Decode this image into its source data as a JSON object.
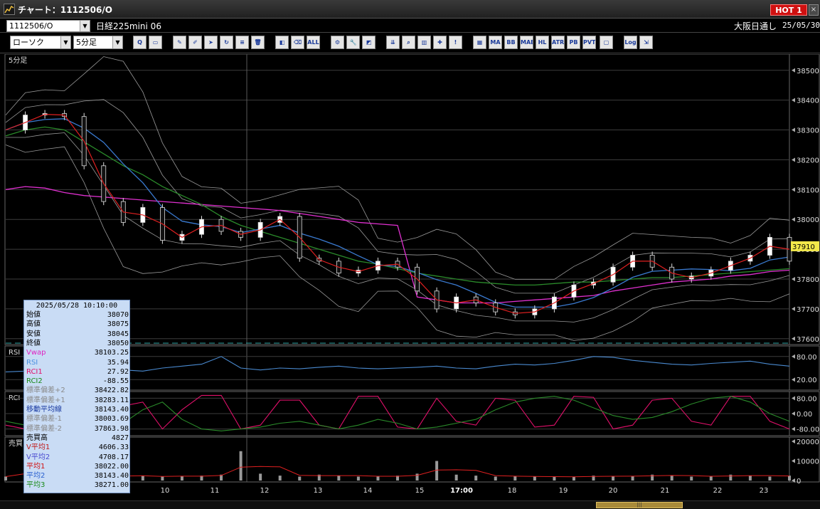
{
  "window": {
    "title": "チャート：1112506/O",
    "hot_label": "HOT 1",
    "close_label": "×"
  },
  "symbol_bar": {
    "code": "1112506/O",
    "product": "日経225mini 06",
    "session": "大阪日通し",
    "date": "25/05/30"
  },
  "selectors": {
    "chart_type": "ローソク",
    "interval": "5分足"
  },
  "toolbar_buttons": [
    {
      "name": "zoom-tool",
      "icon": "magnifier-icon",
      "label": "Q"
    },
    {
      "name": "window-tool",
      "icon": "window-icon",
      "label": "▭"
    },
    {
      "name": "pen-tool",
      "icon": "pen-icon",
      "label": "✎"
    },
    {
      "name": "draw-tool",
      "icon": "draw-icon",
      "label": "✐"
    },
    {
      "name": "cursor-tool",
      "icon": "cursor-icon",
      "label": "➤"
    },
    {
      "name": "redo-tool",
      "icon": "redo-icon",
      "label": "↻"
    },
    {
      "name": "notes-tool",
      "icon": "notes-icon",
      "label": "≡"
    },
    {
      "name": "trash-tool",
      "icon": "trash-icon",
      "label": "🗑"
    },
    {
      "name": "hide-tool",
      "icon": "hide-icon",
      "label": "◧"
    },
    {
      "name": "delete-tool",
      "icon": "delete-icon",
      "label": "⌫"
    },
    {
      "name": "all-tool",
      "icon": "all-icon",
      "label": "ALL"
    },
    {
      "name": "settings-tool",
      "icon": "gear-icon",
      "label": "⚙"
    },
    {
      "name": "wrench-tool",
      "icon": "wrench-icon",
      "label": "🔧"
    },
    {
      "name": "color-tool",
      "icon": "palette-icon",
      "label": "◩"
    },
    {
      "name": "order-tool",
      "icon": "order-icon",
      "label": "⇊"
    },
    {
      "name": "search-tool",
      "icon": "search-icon",
      "label": "⌕"
    },
    {
      "name": "chart-tool",
      "icon": "chart-icon",
      "label": "▥"
    },
    {
      "name": "mark-tool",
      "icon": "mark-icon",
      "label": "✚"
    },
    {
      "name": "disabled-tool",
      "icon": "disabled-icon",
      "label": "!"
    },
    {
      "name": "volume-tool",
      "icon": "volume-icon",
      "label": "▦"
    },
    {
      "name": "ma-tool",
      "icon": "ma-icon",
      "label": "MA"
    },
    {
      "name": "bb-tool",
      "icon": "bb-icon",
      "label": "BB"
    },
    {
      "name": "mae-tool",
      "icon": "mae-icon",
      "label": "MAE"
    },
    {
      "name": "hl-tool",
      "icon": "hl-icon",
      "label": "HL"
    },
    {
      "name": "atr-tool",
      "icon": "atr-icon",
      "label": "ATR"
    },
    {
      "name": "pb-tool",
      "icon": "pb-icon",
      "label": "PB"
    },
    {
      "name": "pvt-tool",
      "icon": "pvt-icon",
      "label": "PVT"
    },
    {
      "name": "frame-tool",
      "icon": "frame-icon",
      "label": "▢"
    },
    {
      "name": "log-tool",
      "icon": "log-icon",
      "label": "Log"
    },
    {
      "name": "export-tool",
      "icon": "export-icon",
      "label": "⇲"
    }
  ],
  "panes": {
    "price_label": "5分足",
    "rsi_label": "RSI",
    "rci_label": "RCI",
    "volume_label": "売買"
  },
  "price_axis": {
    "ticks": [
      "38500",
      "38400",
      "38300",
      "38200",
      "38100",
      "38000",
      "37900",
      "37800",
      "37700",
      "37600"
    ],
    "current": "37910"
  },
  "rsi_axis": {
    "ticks": [
      "80.00",
      "20.00"
    ]
  },
  "rci_axis": {
    "ticks": [
      "80.00",
      "0.00",
      "-80.00"
    ]
  },
  "volume_axis": {
    "ticks": [
      "20000",
      "10000",
      "0"
    ]
  },
  "time_axis": {
    "ticks": [
      "10",
      "11",
      "12",
      "13",
      "14",
      "15",
      "17:00",
      "18",
      "19",
      "20",
      "21",
      "22",
      "23"
    ]
  },
  "info_panel": {
    "datetime": "2025/05/28 10:10:00",
    "rows": [
      {
        "label": "始値",
        "value": "38070",
        "color": "#000000"
      },
      {
        "label": "高値",
        "value": "38075",
        "color": "#000000"
      },
      {
        "label": "安値",
        "value": "38045",
        "color": "#000000"
      },
      {
        "label": "終値",
        "value": "38050",
        "color": "#000000"
      },
      {
        "label": "Vwap",
        "value": "38103.25",
        "color": "#e020c0"
      },
      {
        "label": "RSI",
        "value": "35.94",
        "color": "#4a90e0"
      },
      {
        "label": "RCI1",
        "value": "27.92",
        "color": "#e0106a"
      },
      {
        "label": "RCI2",
        "value": "-88.55",
        "color": "#1a8a1a"
      },
      {
        "label": "標準偏差+2",
        "value": "38422.82",
        "color": "#8a8a8a"
      },
      {
        "label": "標準偏差+1",
        "value": "38283.11",
        "color": "#8a8a8a"
      },
      {
        "label": "移動平均線",
        "value": "38143.40",
        "color": "#1a3aa0"
      },
      {
        "label": "標準偏差-1",
        "value": "38003.69",
        "color": "#8a8a8a"
      },
      {
        "label": "標準偏差-2",
        "value": "37863.98",
        "color": "#8a8a8a"
      },
      {
        "label": "売買高",
        "value": "4827",
        "color": "#000000"
      },
      {
        "label": "V平均1",
        "value": "4606.33",
        "color": "#c01a1a"
      },
      {
        "label": "V平均2",
        "value": "4708.17",
        "color": "#4a4ad0"
      },
      {
        "label": "平均1",
        "value": "38022.00",
        "color": "#d01010"
      },
      {
        "label": "平均2",
        "value": "38143.40",
        "color": "#2a60d0"
      },
      {
        "label": "平均3",
        "value": "38271.00",
        "color": "#1a8a1a"
      }
    ]
  },
  "colors": {
    "ma_short": "#e02020",
    "ma_mid": "#3a7ad0",
    "ma_long": "#2a8a2a",
    "vwap": "#e030d0",
    "bollinger": "#9a9a9a",
    "rsi": "#4a8ad0",
    "rci1": "#e0106a",
    "rci2": "#2a8a2a",
    "volume": "#9a9a9a"
  },
  "chart_data": {
    "type": "line",
    "price_range": [
      37590,
      38540
    ],
    "x": [
      0,
      5,
      10,
      15,
      20,
      25,
      30,
      35,
      40,
      45,
      50,
      55,
      60,
      65,
      70,
      75,
      80,
      85,
      90,
      95,
      100,
      105,
      110,
      115,
      120,
      125,
      130,
      135,
      140,
      145,
      150,
      155,
      160,
      165,
      170,
      175,
      180,
      185,
      190,
      195,
      200
    ],
    "close": [
      38300,
      38350,
      38355,
      38345,
      38180,
      38060,
      37990,
      38040,
      37930,
      37950,
      38000,
      37960,
      37940,
      37990,
      38010,
      37870,
      37860,
      37820,
      37830,
      37860,
      37840,
      37760,
      37700,
      37740,
      37720,
      37690,
      37680,
      37700,
      37740,
      37780,
      37790,
      37840,
      37880,
      37840,
      37800,
      37810,
      37830,
      37860,
      37880,
      37940,
      37860
    ],
    "vwap": [
      38100,
      38110,
      38105,
      38090,
      38080,
      38075,
      38070,
      38065,
      38060,
      38055,
      38050,
      38045,
      38040,
      38035,
      38030,
      38020,
      38010,
      38000,
      37990,
      37985,
      37980,
      37740,
      37730,
      37720,
      37720,
      37720,
      37725,
      37730,
      37735,
      37740,
      37745,
      37760,
      37770,
      37780,
      37790,
      37795,
      37800,
      37810,
      37815,
      37825,
      37830
    ],
    "ma_long": [
      38280,
      38300,
      38310,
      38300,
      38260,
      38220,
      38180,
      38150,
      38110,
      38080,
      38050,
      38010,
      37980,
      37960,
      37940,
      37920,
      37900,
      37880,
      37860,
      37850,
      37835,
      37820,
      37810,
      37800,
      37790,
      37785,
      37780,
      37780,
      37785,
      37790,
      37790,
      37795,
      37800,
      37805,
      37805,
      37810,
      37815,
      37820,
      37825,
      37830,
      37835
    ],
    "rsi": [
      40,
      42,
      60,
      55,
      35,
      40,
      45,
      42,
      50,
      55,
      60,
      80,
      50,
      45,
      50,
      48,
      52,
      55,
      50,
      48,
      50,
      52,
      55,
      50,
      48,
      55,
      60,
      58,
      62,
      70,
      80,
      78,
      70,
      65,
      60,
      58,
      62,
      65,
      68,
      60,
      55
    ],
    "rci1": [
      -60,
      -80,
      60,
      70,
      -60,
      -75,
      40,
      60,
      -80,
      20,
      95,
      95,
      -80,
      -60,
      70,
      70,
      -60,
      -80,
      90,
      90,
      -70,
      -80,
      80,
      -40,
      -60,
      80,
      70,
      -70,
      -60,
      90,
      85,
      -80,
      -60,
      70,
      80,
      -40,
      -60,
      90,
      90,
      -40,
      -80
    ],
    "rci2": [
      -40,
      -60,
      -80,
      -75,
      -80,
      -70,
      -50,
      20,
      60,
      -30,
      -80,
      -90,
      -80,
      -70,
      -50,
      -40,
      -60,
      -80,
      -60,
      -30,
      -50,
      -80,
      -70,
      -50,
      -30,
      20,
      60,
      80,
      90,
      70,
      30,
      -10,
      -30,
      -20,
      10,
      50,
      80,
      90,
      60,
      0,
      -40
    ],
    "volume": [
      2000,
      5000,
      3000,
      2500,
      2000,
      3000,
      1800,
      2500,
      2000,
      2200,
      2500,
      3000,
      15000,
      3500,
      2500,
      2000,
      3000,
      2500,
      2000,
      2000,
      2500,
      3500,
      10000,
      3000,
      2500,
      2000,
      2200,
      2000,
      1800,
      2000,
      2500,
      2000,
      2200,
      3000,
      2500,
      2000,
      2000,
      3000,
      2500,
      2000,
      2500
    ]
  }
}
